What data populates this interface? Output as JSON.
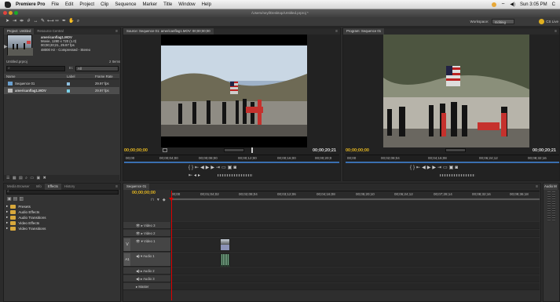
{
  "menubar": {
    "app": "Premiere Pro",
    "items": [
      "File",
      "Edit",
      "Project",
      "Clip",
      "Sequence",
      "Marker",
      "Title",
      "Window",
      "Help"
    ],
    "clock": "Sun 3:05 PM",
    "user": "C"
  },
  "window": {
    "path": "/Users/neyl/Desktop/Untitled.prproj *"
  },
  "toolbar": {
    "workspace_label": "Workspace:",
    "workspace_value": "Editing",
    "cs_live": "CS Live"
  },
  "project_panel": {
    "tabs": [
      "Project: Untitled",
      "Resource Central"
    ],
    "clip": {
      "name": "americanflag1.MOV",
      "line1": "Movie, 1280 x 720 (1.0)",
      "line2": "00;00;20;21, 29.97 fps",
      "line3": "48000 Hz - Compressed - Stereo"
    },
    "project_name": "Untitled.prproj",
    "items_count": "2 Items",
    "in_label": "In:",
    "in_value": "All",
    "columns": [
      "Name",
      "Label",
      "Frame Rate"
    ],
    "rows": [
      {
        "name": "Sequence 01",
        "rate": "29.97 fps",
        "label_color": "#8fc0e0"
      },
      {
        "name": "americanflag1.MOV",
        "rate": "29.97 fps",
        "label_color": "#7ad0e8"
      }
    ]
  },
  "source_monitor": {
    "tab": "Source: Sequence 01: americanflag1.MOV: 00;00;00;00",
    "tc_in": "00;00;00;00",
    "tc_out": "00;00;20;21",
    "ruler": [
      "00;00",
      "00;00;04;00",
      "00;00;08;00",
      "00;00;12;00",
      "00;00;16;00",
      "00;00;20;0"
    ]
  },
  "program_monitor": {
    "tab": "Program: Sequence 01",
    "tc_in": "00;00;00;00",
    "tc_out": "00;00;20;21",
    "ruler": [
      "00;00",
      "00;02;08;04",
      "00;04;16;08",
      "00;06;24;12",
      "00;08;32;16"
    ]
  },
  "effects_panel": {
    "tabs": [
      "Media Browser",
      "Info",
      "Effects",
      "History"
    ],
    "folders": [
      "Presets",
      "Audio Effects",
      "Audio Transitions",
      "Video Effects",
      "Video Transitions"
    ]
  },
  "timeline": {
    "tab": "Sequence 01",
    "timecode": "00;00;00;00",
    "ruler": [
      "00;00",
      "00;01;04;02",
      "00;02;08;04",
      "00;03;12;06",
      "00;04;16;08",
      "00;05;20;10",
      "00;06;24;12",
      "00;07;28;14",
      "00;08;32;16",
      "00;09;36;18"
    ],
    "tracks": [
      "Video 3",
      "Video 2",
      "Video 1",
      "Audio 1",
      "Audio 2",
      "Audio 3",
      "Master"
    ],
    "side_labels": [
      "V",
      "A1"
    ]
  },
  "audio_panel": {
    "tab": "Audio M"
  }
}
